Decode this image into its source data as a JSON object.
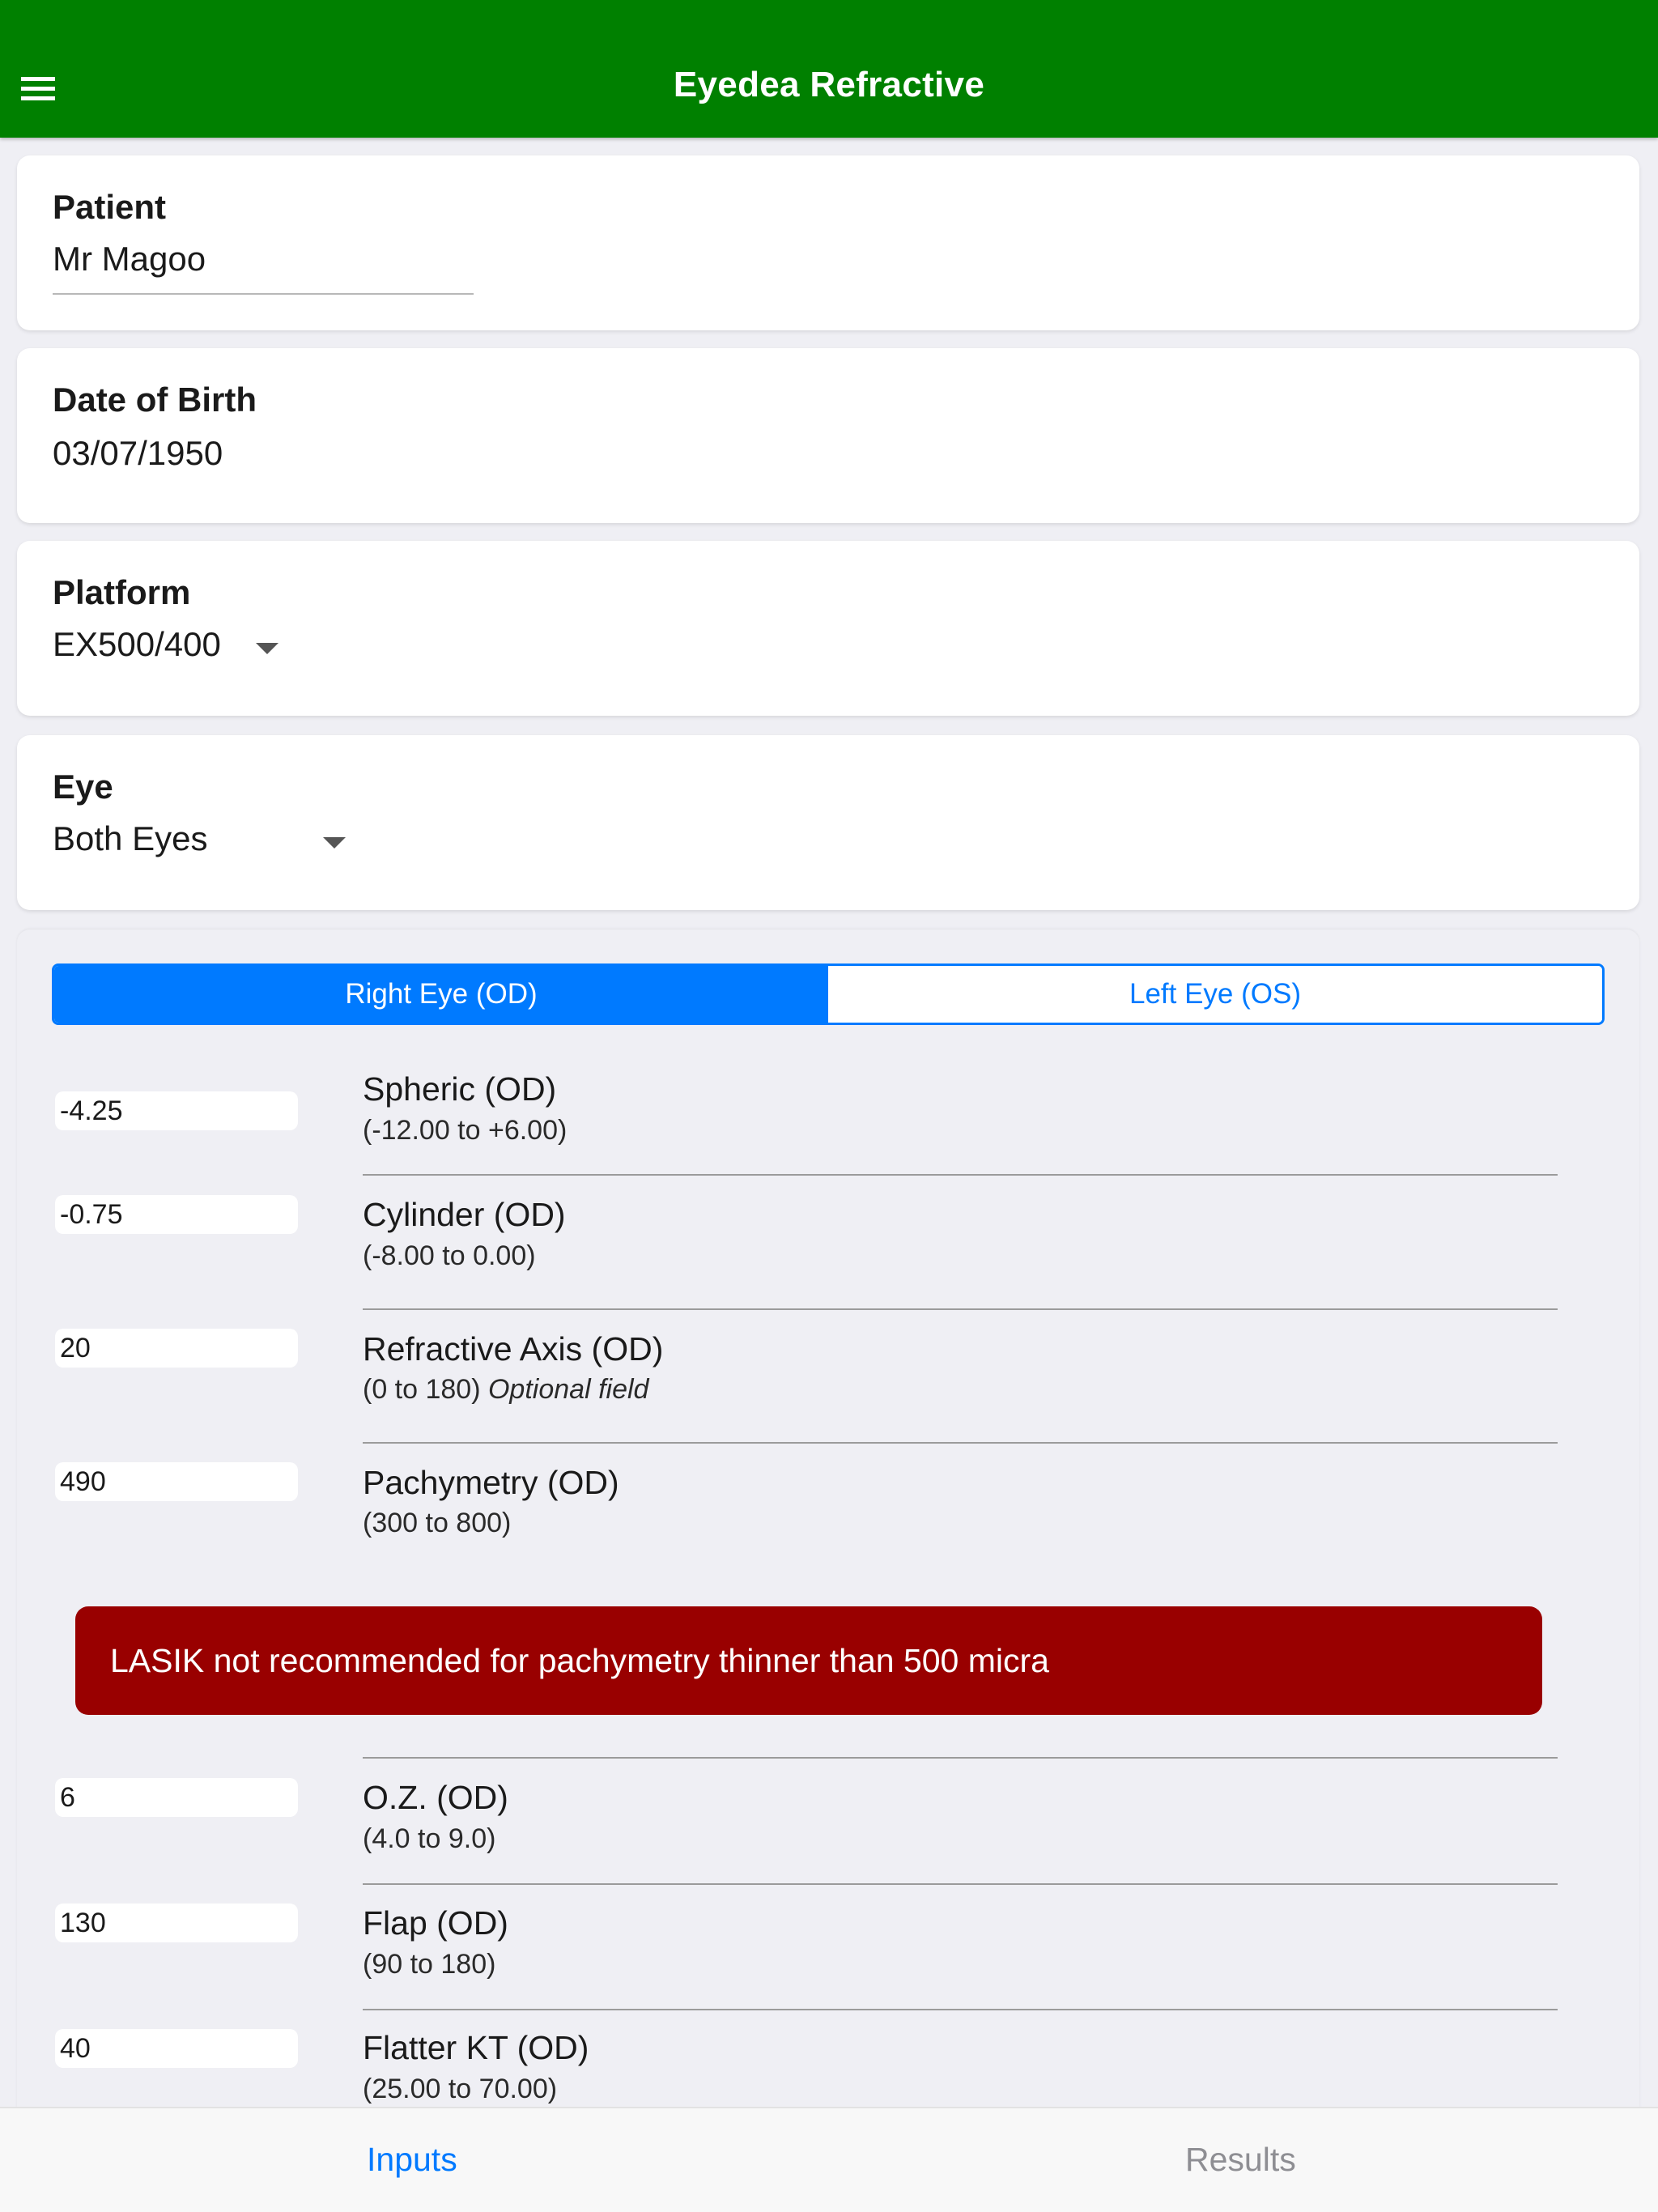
{
  "app": {
    "title": "Eyedea Refractive"
  },
  "patient": {
    "label": "Patient",
    "value": "Mr Magoo"
  },
  "dob": {
    "label": "Date of Birth",
    "value": "03/07/1950"
  },
  "platform": {
    "label": "Platform",
    "value": "EX500/400"
  },
  "eye": {
    "label": "Eye",
    "value": "Both Eyes"
  },
  "segments": {
    "right": "Right Eye (OD)",
    "left": "Left Eye (OS)",
    "selected": "right"
  },
  "fields": [
    {
      "value": "-4.25",
      "title": "Spheric (OD)",
      "range": "(-12.00 to +6.00)",
      "note": ""
    },
    {
      "value": "-0.75",
      "title": "Cylinder (OD)",
      "range": "(-8.00 to 0.00)",
      "note": ""
    },
    {
      "value": "20",
      "title": "Refractive Axis (OD)",
      "range": "(0 to 180) ",
      "note": "Optional field"
    },
    {
      "value": "490",
      "title": "Pachymetry (OD)",
      "range": "(300 to 800)",
      "note": ""
    },
    {
      "value": "6",
      "title": "O.Z. (OD)",
      "range": "(4.0 to 9.0)",
      "note": ""
    },
    {
      "value": "130",
      "title": "Flap (OD)",
      "range": "(90 to 180)",
      "note": ""
    },
    {
      "value": "40",
      "title": "Flatter KT (OD)",
      "range": "(25.00 to 70.00)",
      "note": ""
    }
  ],
  "alert": {
    "text": "LASIK not recommended for pachymetry thinner than 500 micra"
  },
  "tabs": {
    "inputs": "Inputs",
    "results": "Results",
    "selected": "inputs"
  },
  "colors": {
    "appbar": "#008000",
    "accent": "#007aff",
    "alert": "#990000"
  }
}
